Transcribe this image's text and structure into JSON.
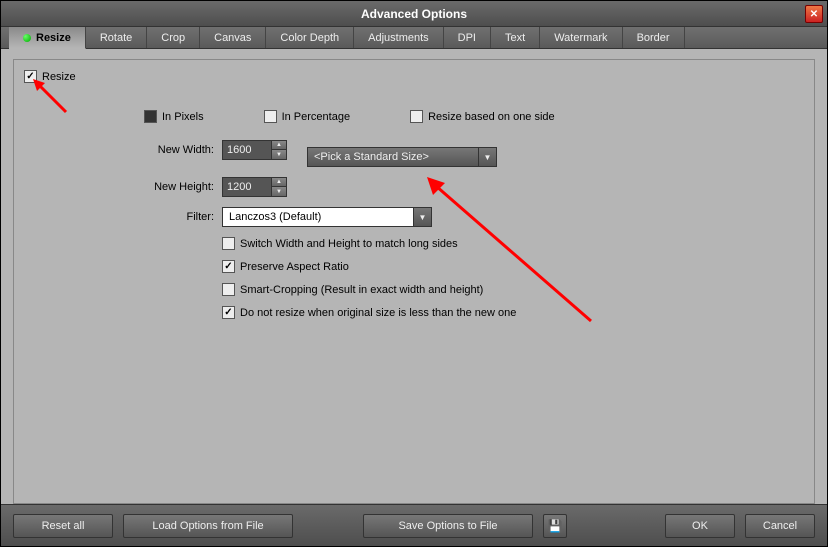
{
  "window": {
    "title": "Advanced Options"
  },
  "tabs": [
    "Resize",
    "Rotate",
    "Crop",
    "Canvas",
    "Color Depth",
    "Adjustments",
    "DPI",
    "Text",
    "Watermark",
    "Border"
  ],
  "panel": {
    "enable_label": "Resize",
    "mode": {
      "pixels": "In Pixels",
      "percentage": "In Percentage",
      "one_side": "Resize based on one side"
    },
    "width_label": "New Width:",
    "width_value": "1600",
    "height_label": "New Height:",
    "height_value": "1200",
    "standard_size": "<Pick a Standard Size>",
    "filter_label": "Filter:",
    "filter_value": "Lanczos3 (Default)",
    "opts": {
      "switch": "Switch Width and Height to match long sides",
      "preserve": "Preserve Aspect Ratio",
      "smartcrop": "Smart-Cropping (Result in exact width and height)",
      "noupscale": "Do not resize when original size is less than the new one"
    }
  },
  "footer": {
    "reset": "Reset all",
    "load": "Load Options from File",
    "save": "Save Options to File",
    "ok": "OK",
    "cancel": "Cancel"
  }
}
